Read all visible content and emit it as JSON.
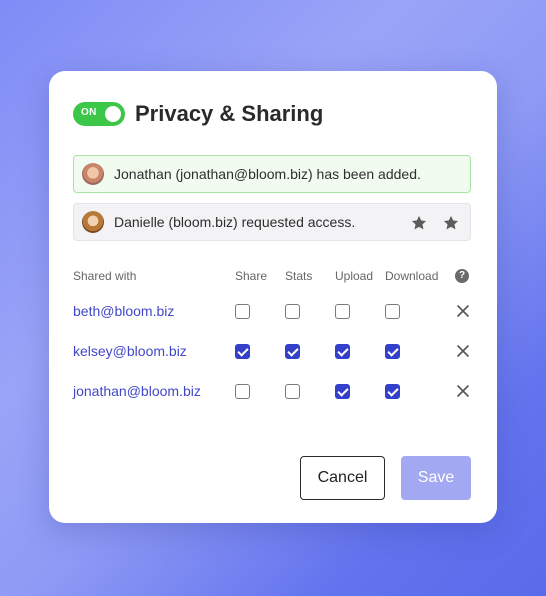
{
  "header": {
    "toggle_label": "ON",
    "title": "Privacy & Sharing"
  },
  "notices": {
    "added": "Jonathan (jonathan@bloom.biz) has been added.",
    "request": "Danielle (bloom.biz) requested access."
  },
  "table": {
    "headers": {
      "shared_with": "Shared with",
      "share": "Share",
      "stats": "Stats",
      "upload": "Upload",
      "download": "Download"
    },
    "rows": [
      {
        "email": "beth@bloom.biz",
        "share": false,
        "stats": false,
        "upload": false,
        "download": false
      },
      {
        "email": "kelsey@bloom.biz",
        "share": true,
        "stats": true,
        "upload": true,
        "download": true
      },
      {
        "email": "jonathan@bloom.biz",
        "share": false,
        "stats": false,
        "upload": true,
        "download": true
      }
    ]
  },
  "buttons": {
    "cancel": "Cancel",
    "save": "Save"
  },
  "colors": {
    "toggle_on": "#3cc748",
    "checkbox_checked": "#3440c9",
    "email_link": "#4148c8",
    "save_disabled": "#a2a8f1"
  },
  "icons": {
    "help": "question-circle-icon",
    "remove": "close-icon",
    "star": "star-icon"
  }
}
